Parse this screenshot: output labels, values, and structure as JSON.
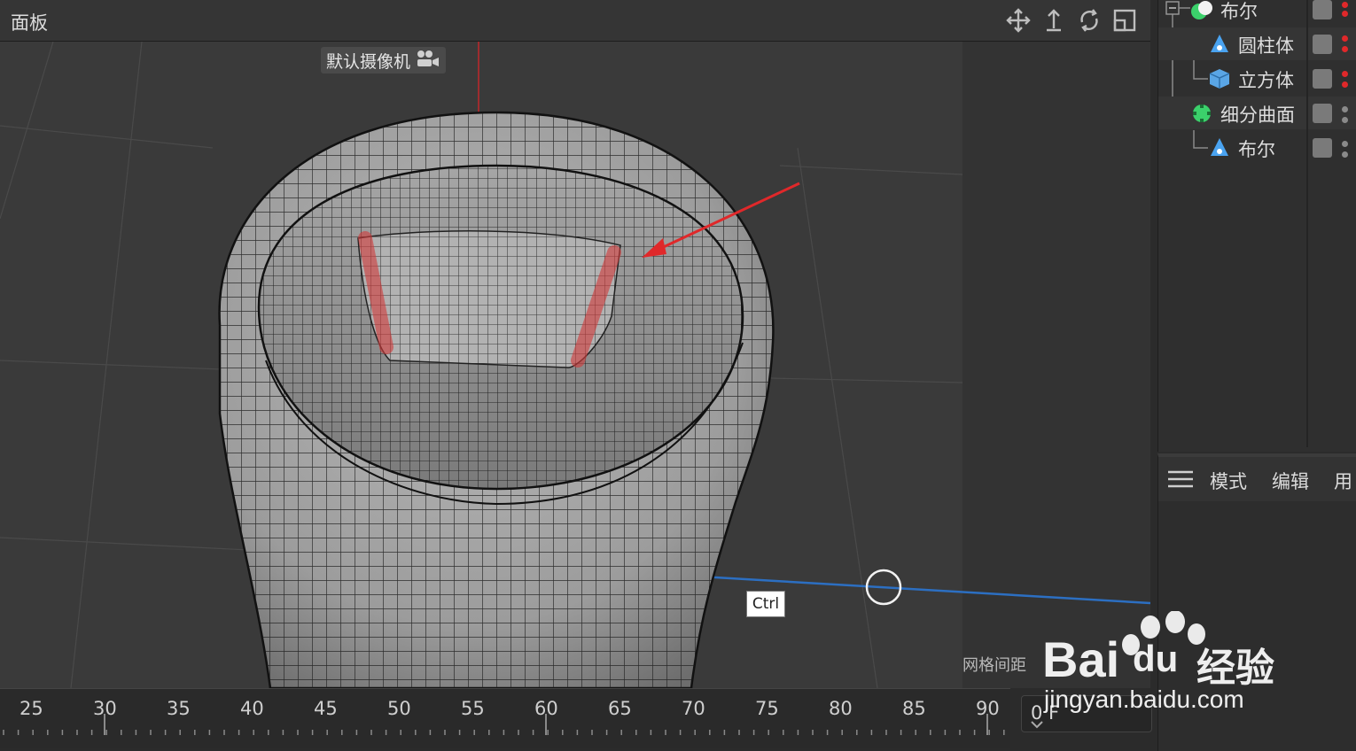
{
  "viewport": {
    "panel_title": "面板",
    "camera_label": "默认摄像机",
    "grid_spacing_label": "网格间距",
    "tooltip_key": "Ctrl",
    "nav_icons": [
      "move-icon",
      "pan-icon",
      "rotate-icon",
      "maximize-icon"
    ]
  },
  "object_manager": {
    "items": [
      {
        "label": "布尔",
        "icon": "boole-icon",
        "level": 0
      },
      {
        "label": "圆柱体",
        "icon": "cylinder-icon",
        "level": 1
      },
      {
        "label": "立方体",
        "icon": "cube-icon",
        "level": 1
      },
      {
        "label": "细分曲面",
        "icon": "subdivision-surface-icon",
        "level": 0
      },
      {
        "label": "布尔",
        "icon": "boole-icon",
        "level": 1
      }
    ]
  },
  "attribute_manager": {
    "menu": [
      "模式",
      "编辑",
      "用"
    ]
  },
  "timeline": {
    "ticks": [
      "25",
      "30",
      "35",
      "40",
      "45",
      "50",
      "55",
      "60",
      "65",
      "70",
      "75",
      "80",
      "85",
      "90"
    ],
    "current_frame": "0 F"
  },
  "watermark": {
    "brand": "Bai",
    "brand2": "du",
    "brand_cn": "经验",
    "url": "jingyan.baidu.com"
  },
  "colors": {
    "accent_red": "#e0282a",
    "axis_blue": "#2c6fc2",
    "mesh_gray": "#9a9a9a"
  }
}
